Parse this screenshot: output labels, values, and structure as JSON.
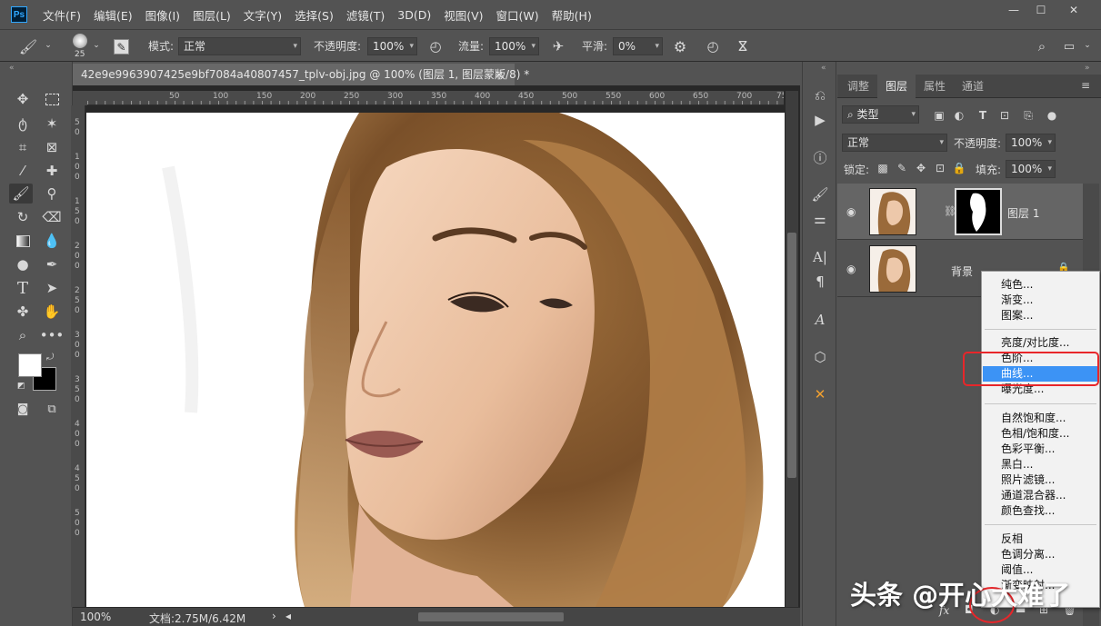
{
  "app": {
    "logo": "Ps"
  },
  "menu": [
    "文件(F)",
    "编辑(E)",
    "图像(I)",
    "图层(L)",
    "文字(Y)",
    "选择(S)",
    "滤镜(T)",
    "3D(D)",
    "视图(V)",
    "窗口(W)",
    "帮助(H)"
  ],
  "window_buttons": [
    "—",
    "☐",
    "✕"
  ],
  "options": {
    "brush_size": "25",
    "mode_label": "模式:",
    "mode_value": "正常",
    "opacity_label": "不透明度:",
    "opacity_value": "100%",
    "flow_label": "流量:",
    "flow_value": "100%",
    "smooth_label": "平滑:",
    "smooth_value": "0%"
  },
  "document": {
    "tab_title": "42e9e9963907425e9bf7084a40807457_tplv-obj.jpg @ 100% (图层 1, 图层蒙版/8) *",
    "close": "×",
    "ruler_top": [
      "50",
      "100",
      "150",
      "200",
      "250",
      "300",
      "350",
      "400",
      "450",
      "500",
      "550",
      "600",
      "650",
      "700",
      "750"
    ],
    "ruler_left": [
      "5",
      "0",
      "1",
      "0",
      "0",
      "1",
      "5",
      "0",
      "2",
      "0",
      "0",
      "2",
      "5",
      "0",
      "3",
      "0",
      "0",
      "3",
      "5",
      "0",
      "4",
      "0",
      "0",
      "4",
      "5",
      "0",
      "5",
      "0",
      "0"
    ],
    "zoom": "100%",
    "doc_info": "文档:2.75M/6.42M",
    "status_arrow": "›"
  },
  "panel": {
    "tabs": [
      "调整",
      "图层",
      "属性",
      "通道"
    ],
    "active_tab": "图层",
    "filter_label": "类型",
    "blend_mode": "正常",
    "opacity_label": "不透明度:",
    "opacity_value": "100%",
    "lock_label": "锁定:",
    "fill_label": "填充:",
    "fill_value": "100%",
    "layers": [
      {
        "name": "图层 1",
        "selected": true
      },
      {
        "name": "背景",
        "selected": false
      }
    ],
    "fx_label": "fx"
  },
  "context_menu": {
    "group1": [
      "纯色...",
      "渐变...",
      "图案..."
    ],
    "group2": [
      "亮度/对比度...",
      "色阶...",
      "曲线...",
      "曝光度..."
    ],
    "group3": [
      "自然饱和度...",
      "色相/饱和度...",
      "色彩平衡...",
      "黑白...",
      "照片滤镜...",
      "通道混合器...",
      "颜色查找..."
    ],
    "group4": [
      "反相",
      "色调分离...",
      "阈值...",
      "渐变映射..."
    ],
    "highlighted": "曲线..."
  },
  "watermark": "头条 @开心大难了",
  "colors": {
    "highlight": "#3c93f5",
    "annotation_red": "#e8262a",
    "foreground": "#ffffff",
    "background": "#000000"
  }
}
